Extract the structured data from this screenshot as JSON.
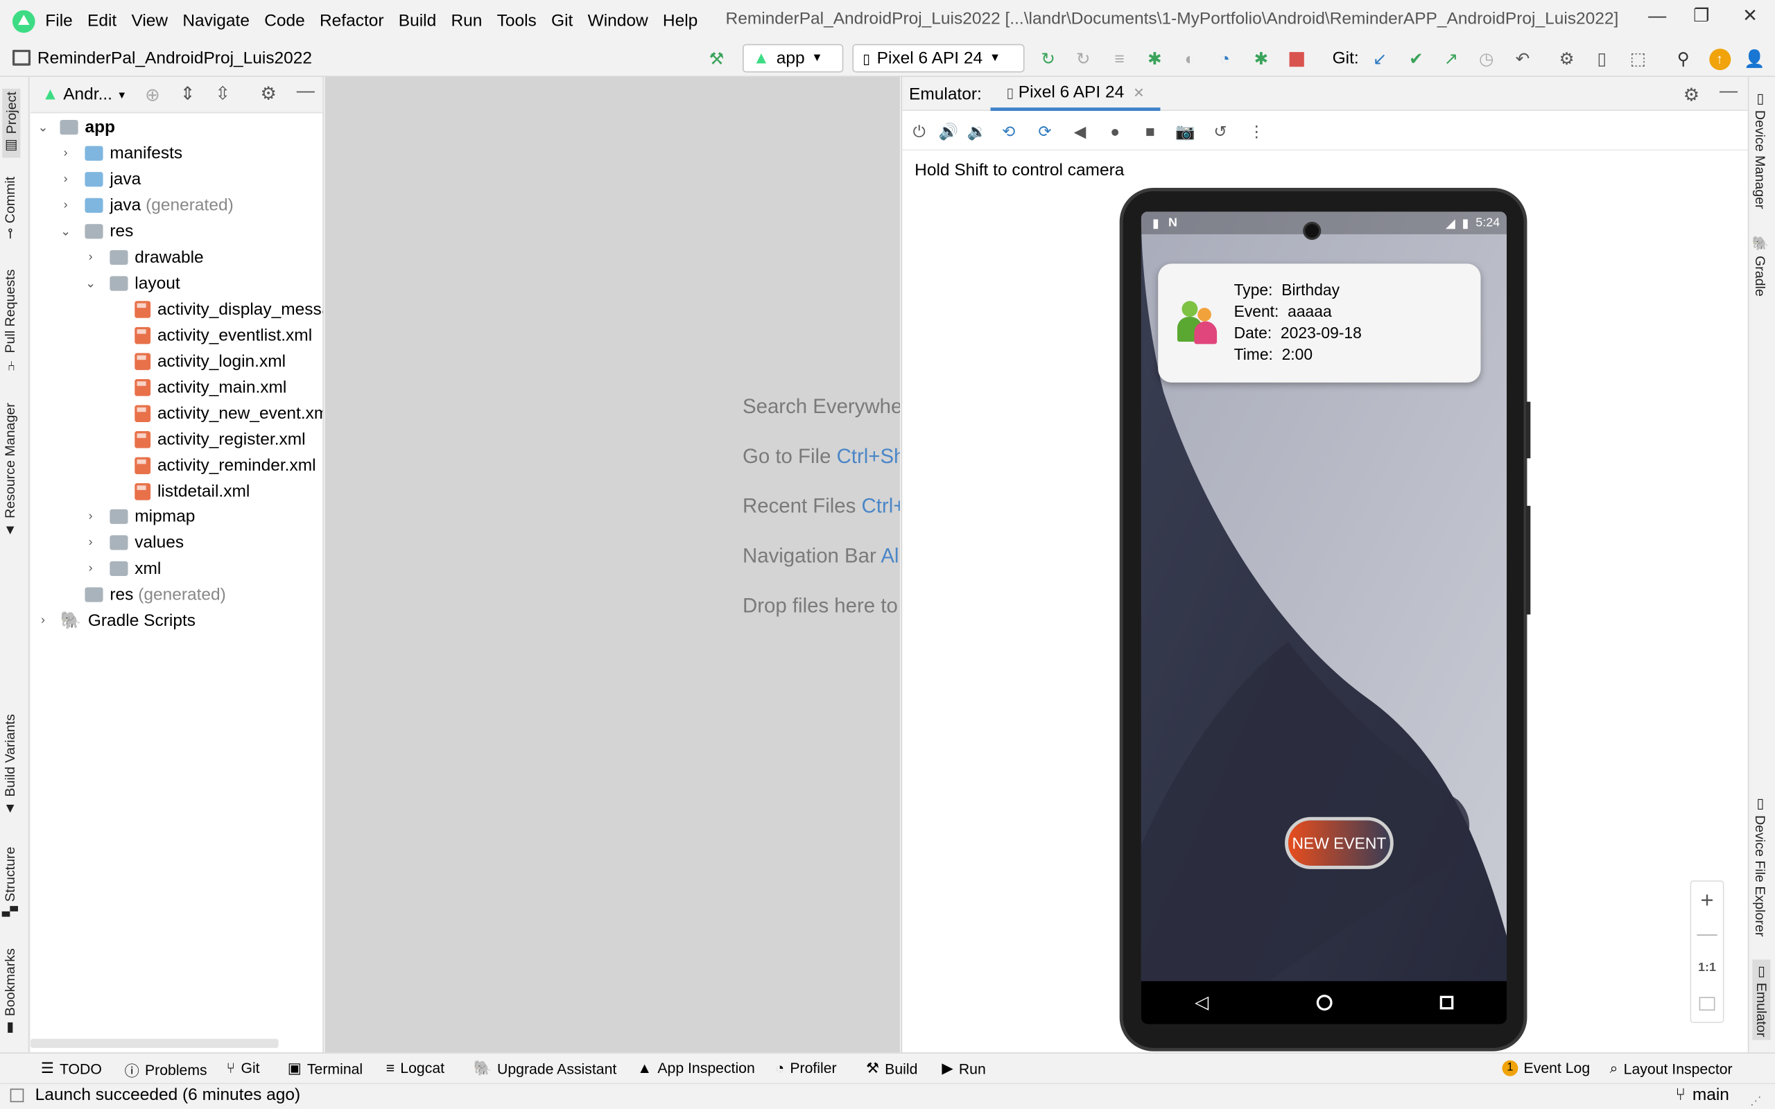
{
  "menu": [
    "File",
    "Edit",
    "View",
    "Navigate",
    "Code",
    "Refactor",
    "Build",
    "Run",
    "Tools",
    "Git",
    "Window",
    "Help"
  ],
  "window_title": "ReminderPal_AndroidProj_Luis2022 [...\\landr\\Documents\\1-MyPortfolio\\Android\\ReminderAPP_AndroidProj_Luis2022]",
  "project_name": "ReminderPal_AndroidProj_Luis2022",
  "run_config": "app",
  "device": "Pixel 6 API 24",
  "git_label": "Git:",
  "left_tabs": [
    "Project",
    "Commit",
    "Pull Requests",
    "Resource Manager",
    "Build Variants",
    "Structure",
    "Bookmarks"
  ],
  "right_tabs": [
    "Device Manager",
    "Gradle",
    "Device File Explorer",
    "Emulator"
  ],
  "project_view": "Andr...",
  "tree": {
    "app": "app",
    "manifests": "manifests",
    "java": "java",
    "java_gen": "java",
    "java_gen_suffix": "(generated)",
    "res": "res",
    "drawable": "drawable",
    "layout": "layout",
    "files": [
      "activity_display_messag",
      "activity_eventlist.xml",
      "activity_login.xml",
      "activity_main.xml",
      "activity_new_event.xm",
      "activity_register.xml",
      "activity_reminder.xml",
      "listdetail.xml"
    ],
    "mipmap": "mipmap",
    "values": "values",
    "xml": "xml",
    "res_gen": "res",
    "res_gen_suffix": "(generated)",
    "gradle": "Gradle Scripts"
  },
  "editor_hints": [
    {
      "text": "Search Everywher",
      "key": ""
    },
    {
      "text": "Go to File ",
      "key": "Ctrl+Sh"
    },
    {
      "text": "Recent Files ",
      "key": "Ctrl+"
    },
    {
      "text": "Navigation Bar ",
      "key": "Al"
    },
    {
      "text": "Drop files here to",
      "key": ""
    }
  ],
  "emulator": {
    "label": "Emulator:",
    "tab": "Pixel 6 API 24",
    "hint": "Hold Shift to control camera",
    "time": "5:24",
    "card": {
      "type_label": "Type:",
      "type": "Birthday",
      "event_label": "Event:",
      "event": "aaaaa",
      "date_label": "Date:",
      "date": "2023-09-18",
      "time_label": "Time:",
      "time": "2:00"
    },
    "button": "NEW EVENT",
    "zoom_ratio": "1:1"
  },
  "bottom_tabs": [
    "TODO",
    "Problems",
    "Git",
    "Terminal",
    "Logcat",
    "Upgrade Assistant",
    "App Inspection",
    "Profiler",
    "Build",
    "Run"
  ],
  "event_log": "Event Log",
  "event_log_count": "1",
  "layout_inspector": "Layout Inspector",
  "status": "Launch succeeded (6 minutes ago)",
  "branch": "main"
}
